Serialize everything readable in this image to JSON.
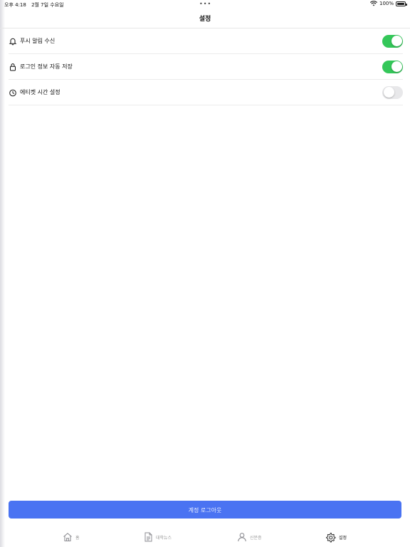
{
  "status_bar": {
    "time": "오후 4:18",
    "date": "2월 7일 수요일",
    "dots": "•••",
    "battery": "100%"
  },
  "header": {
    "title": "설정"
  },
  "settings": [
    {
      "label": "푸시 알림 수신",
      "icon": "bell-icon",
      "enabled": true
    },
    {
      "label": "로그인 정보 자동 저장",
      "icon": "lock-icon",
      "enabled": true
    },
    {
      "label": "에티켓 시간 설정",
      "icon": "timer-icon",
      "enabled": false
    }
  ],
  "logout_button": {
    "label": "계정 로그아웃"
  },
  "tabs": [
    {
      "label": "홈",
      "icon": "home-icon",
      "active": false
    },
    {
      "label": "대학뉴스",
      "icon": "document-icon",
      "active": false
    },
    {
      "label": "신분증",
      "icon": "person-icon",
      "active": false
    },
    {
      "label": "설정",
      "icon": "gear-icon",
      "active": true
    }
  ],
  "colors": {
    "toggle_on": "#34c759",
    "toggle_off": "#e8e8ea",
    "primary_button": "#4a73f2"
  }
}
